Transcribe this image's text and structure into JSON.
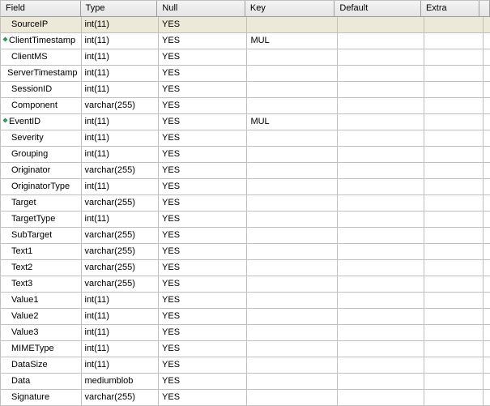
{
  "chart_data": {
    "type": "table",
    "columns": [
      "Field",
      "Type",
      "Null",
      "Key",
      "Default",
      "Extra"
    ],
    "rows": [
      {
        "field": "SourceIP",
        "type": "int(11)",
        "null": "YES",
        "key": "",
        "default": "",
        "extra": "",
        "indent": 1,
        "marker": false,
        "grey": true
      },
      {
        "field": "ClientTimestamp",
        "type": "int(11)",
        "null": "YES",
        "key": "MUL",
        "default": "",
        "extra": "",
        "indent": 0,
        "marker": true,
        "grey": false
      },
      {
        "field": "ClientMS",
        "type": "int(11)",
        "null": "YES",
        "key": "",
        "default": "",
        "extra": "",
        "indent": 1,
        "marker": false,
        "grey": false
      },
      {
        "field": "ServerTimestamp",
        "type": "int(11)",
        "null": "YES",
        "key": "",
        "default": "",
        "extra": "",
        "indent": 1,
        "marker": false,
        "grey": false
      },
      {
        "field": "SessionID",
        "type": "int(11)",
        "null": "YES",
        "key": "",
        "default": "",
        "extra": "",
        "indent": 1,
        "marker": false,
        "grey": false
      },
      {
        "field": "Component",
        "type": "varchar(255)",
        "null": "YES",
        "key": "",
        "default": "",
        "extra": "",
        "indent": 1,
        "marker": false,
        "grey": false
      },
      {
        "field": "EventID",
        "type": "int(11)",
        "null": "YES",
        "key": "MUL",
        "default": "",
        "extra": "",
        "indent": 0,
        "marker": true,
        "grey": false
      },
      {
        "field": "Severity",
        "type": "int(11)",
        "null": "YES",
        "key": "",
        "default": "",
        "extra": "",
        "indent": 1,
        "marker": false,
        "grey": false
      },
      {
        "field": "Grouping",
        "type": "int(11)",
        "null": "YES",
        "key": "",
        "default": "",
        "extra": "",
        "indent": 1,
        "marker": false,
        "grey": false
      },
      {
        "field": "Originator",
        "type": "varchar(255)",
        "null": "YES",
        "key": "",
        "default": "",
        "extra": "",
        "indent": 1,
        "marker": false,
        "grey": false
      },
      {
        "field": "OriginatorType",
        "type": "int(11)",
        "null": "YES",
        "key": "",
        "default": "",
        "extra": "",
        "indent": 1,
        "marker": false,
        "grey": false
      },
      {
        "field": "Target",
        "type": "varchar(255)",
        "null": "YES",
        "key": "",
        "default": "",
        "extra": "",
        "indent": 1,
        "marker": false,
        "grey": false
      },
      {
        "field": "TargetType",
        "type": "int(11)",
        "null": "YES",
        "key": "",
        "default": "",
        "extra": "",
        "indent": 1,
        "marker": false,
        "grey": false
      },
      {
        "field": "SubTarget",
        "type": "varchar(255)",
        "null": "YES",
        "key": "",
        "default": "",
        "extra": "",
        "indent": 1,
        "marker": false,
        "grey": false
      },
      {
        "field": "Text1",
        "type": "varchar(255)",
        "null": "YES",
        "key": "",
        "default": "",
        "extra": "",
        "indent": 1,
        "marker": false,
        "grey": false
      },
      {
        "field": "Text2",
        "type": "varchar(255)",
        "null": "YES",
        "key": "",
        "default": "",
        "extra": "",
        "indent": 1,
        "marker": false,
        "grey": false
      },
      {
        "field": "Text3",
        "type": "varchar(255)",
        "null": "YES",
        "key": "",
        "default": "",
        "extra": "",
        "indent": 1,
        "marker": false,
        "grey": false
      },
      {
        "field": "Value1",
        "type": "int(11)",
        "null": "YES",
        "key": "",
        "default": "",
        "extra": "",
        "indent": 1,
        "marker": false,
        "grey": false
      },
      {
        "field": "Value2",
        "type": "int(11)",
        "null": "YES",
        "key": "",
        "default": "",
        "extra": "",
        "indent": 1,
        "marker": false,
        "grey": false
      },
      {
        "field": "Value3",
        "type": "int(11)",
        "null": "YES",
        "key": "",
        "default": "",
        "extra": "",
        "indent": 1,
        "marker": false,
        "grey": false
      },
      {
        "field": "MIMEType",
        "type": "int(11)",
        "null": "YES",
        "key": "",
        "default": "",
        "extra": "",
        "indent": 1,
        "marker": false,
        "grey": false
      },
      {
        "field": "DataSize",
        "type": "int(11)",
        "null": "YES",
        "key": "",
        "default": "",
        "extra": "",
        "indent": 1,
        "marker": false,
        "grey": false
      },
      {
        "field": "Data",
        "type": "mediumblob",
        "null": "YES",
        "key": "",
        "default": "",
        "extra": "",
        "indent": 1,
        "marker": false,
        "grey": false
      },
      {
        "field": "Signature",
        "type": "varchar(255)",
        "null": "YES",
        "key": "",
        "default": "",
        "extra": "",
        "indent": 1,
        "marker": false,
        "grey": false
      }
    ]
  },
  "headers": {
    "field": "Field",
    "type": "Type",
    "null": "Null",
    "key": "Key",
    "default": "Default",
    "extra": "Extra"
  }
}
